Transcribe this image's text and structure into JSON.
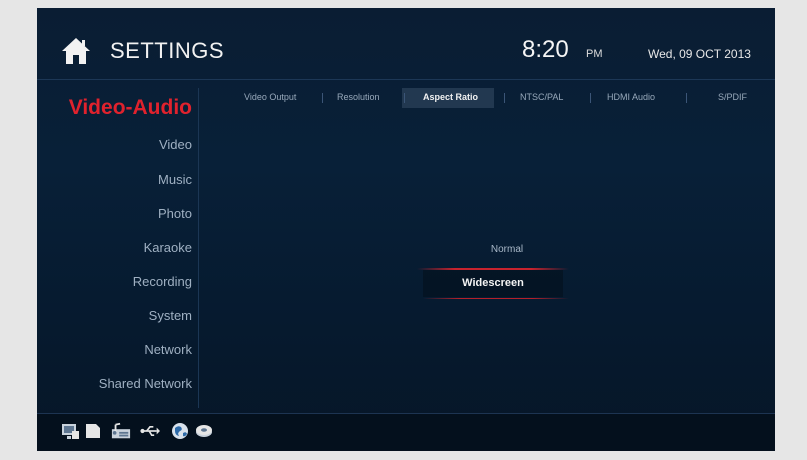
{
  "header": {
    "title": "SETTINGS",
    "time": "8:20",
    "ampm": "PM",
    "date": "Wed, 09 OCT 2013"
  },
  "sidebar": {
    "section": "Video-Audio",
    "items": [
      {
        "label": "Video"
      },
      {
        "label": "Music"
      },
      {
        "label": "Photo"
      },
      {
        "label": "Karaoke"
      },
      {
        "label": "Recording"
      },
      {
        "label": "System"
      },
      {
        "label": "Network"
      },
      {
        "label": "Shared Network"
      }
    ]
  },
  "tabs": [
    {
      "label": "Video Output"
    },
    {
      "label": "Resolution"
    },
    {
      "label": "Aspect Ratio",
      "active": true
    },
    {
      "label": "NTSC/PAL"
    },
    {
      "label": "HDMI Audio"
    },
    {
      "label": "S/PDIF"
    }
  ],
  "options": {
    "items": [
      "Normal",
      "Widescreen"
    ],
    "selected": "Widescreen"
  },
  "footer_icons": [
    "screen-icon",
    "card-icon",
    "music-library-icon",
    "usb-icon",
    "globe-icon",
    "network-drive-icon"
  ],
  "colors": {
    "accent": "#e0222d",
    "background": "#0a1d33"
  }
}
